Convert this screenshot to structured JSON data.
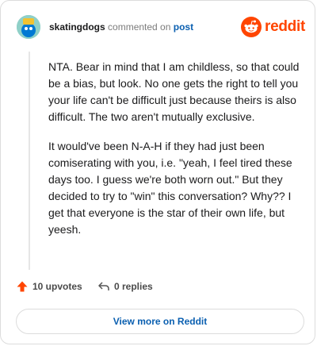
{
  "comment": {
    "username": "skatingdogs",
    "action_text": " commented on ",
    "post_link": "post",
    "paragraphs": [
      "NTA. Bear in mind that I am childless, so that could be a bias, but look. No one gets the right to tell you your life can't be difficult just because theirs is also difficult. The two aren't mutually exclusive.",
      "It would've been N-A-H if they had just been comiserating with you, i.e. \"yeah, I feel tired these days too. I guess we're both worn out.\" But they decided to try to \"win\" this conversation? Why?? I get that everyone is the star of their own life, but yeesh."
    ]
  },
  "brand": {
    "wordmark": "reddit",
    "icon": "reddit-logo-icon",
    "color": "#ff4500"
  },
  "actions": {
    "upvotes_label": "10 upvotes",
    "upvote_icon": "upvote-arrow-icon",
    "replies_label": "0 replies",
    "reply_icon": "reply-arrow-icon"
  },
  "footer": {
    "view_more_label": "View more on Reddit"
  },
  "colors": {
    "link": "#0a5fb0",
    "upvote": "#ff4500"
  }
}
